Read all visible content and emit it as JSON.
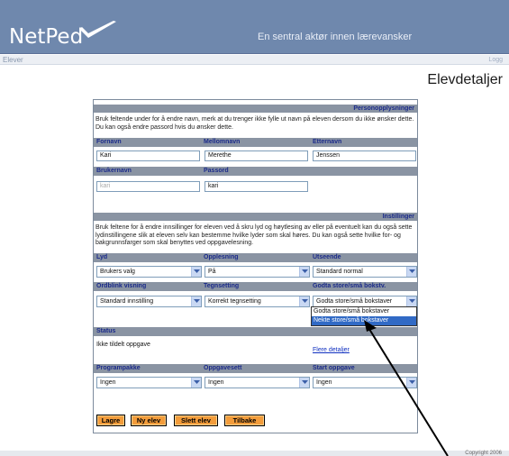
{
  "header": {
    "logo": "NetPed",
    "tagline": "En sentral aktør innen lærevansker"
  },
  "subbar": {
    "left": "Elever",
    "right": "Logg"
  },
  "page_title": "Elevdetaljer",
  "personal": {
    "heading": "Personopplysninger",
    "info": "Bruk feltende under for å endre navn, merk at du trenger ikke fylle ut navn på eleven dersom du ikke ønsker dette. Du kan også endre passord hvis du ønsker dette.",
    "labels": {
      "first": "Fornavn",
      "middle": "Mellomnavn",
      "last": "Etternavn",
      "username": "Brukernavn",
      "password": "Passord"
    },
    "values": {
      "first": "Kari",
      "middle": "Merethe",
      "last": "Jenssen",
      "username": "kari",
      "password": "kari"
    }
  },
  "settings": {
    "heading": "Instillinger",
    "info": "Bruk feltene for å endre innsillinger for eleven ved å skru lyd og  høytlesing av eller på eventuelt kan du også sette lydinstillingene slik at eleven selv kan bestemme hvilke lyder som skal høres. Du kan også sette hvilke for- og bakgrunnsfarger som skal benyttes ved oppgavelesning.",
    "labels": {
      "lyd": "Lyd",
      "opplesning": "Opplesning",
      "utseende": "Utseende",
      "ordblink": "Ordblink visning",
      "tegnsetting": "Tegnsetting",
      "store_sma": "Godta store/små bokstv."
    },
    "values": {
      "lyd": "Brukers valg",
      "opplesning": "På",
      "utseende": "Standard normal",
      "ordblink": "Standard innstilling",
      "tegnsetting": "Korrekt tegnsetting",
      "store_sma": "Godta store/små bokstaver"
    },
    "store_sma_options": [
      "Godta store/små bokstaver",
      "Nekte store/små bokstaver"
    ]
  },
  "status": {
    "label": "Status",
    "text": "Ikke tildelt oppgave",
    "link": "Flere detaljer"
  },
  "program": {
    "labels": {
      "pakke": "Programpakke",
      "oppgavesett": "Oppgavesett",
      "start": "Start oppgave"
    },
    "values": {
      "pakke": "Ingen",
      "oppgavesett": "Ingen",
      "start": "Ingen"
    }
  },
  "buttons": {
    "save": "Lagre",
    "new": "Ny elev",
    "delete": "Slett elev",
    "back": "Tilbake"
  },
  "footer": {
    "copyright": "Copyright 2006"
  },
  "colors": {
    "header": "#6f88ad",
    "section": "#8a94a3",
    "label_text": "#1a2a8a",
    "button": "#f39c3b",
    "selection": "#316ac5"
  }
}
